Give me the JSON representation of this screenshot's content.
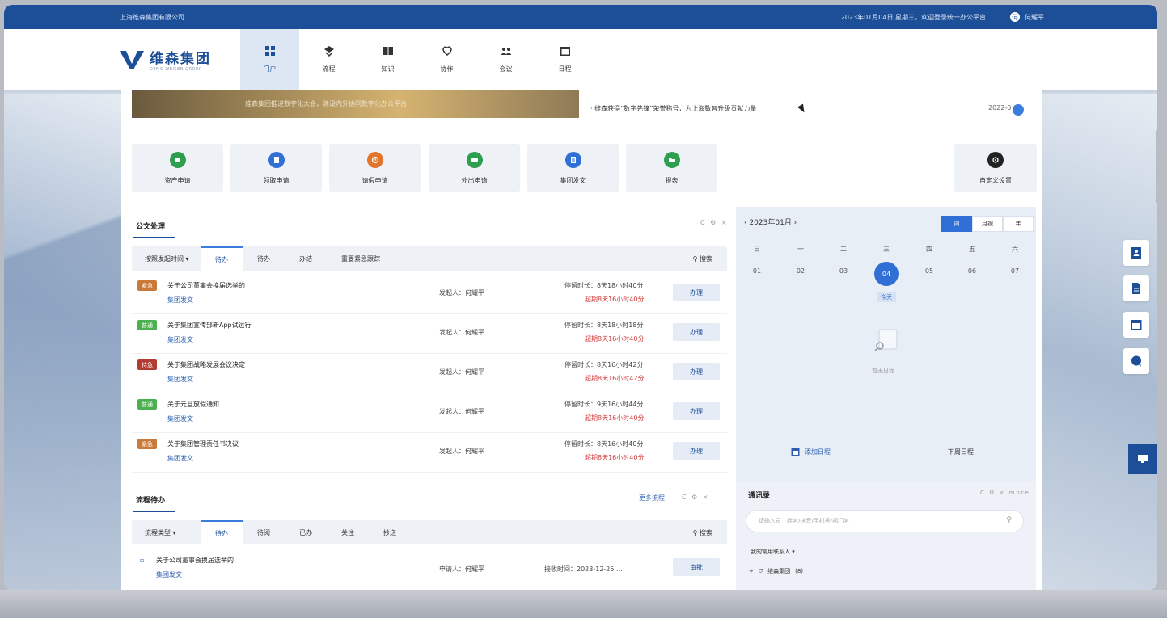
{
  "topbar": {
    "company": "上海维森集团有限公司",
    "date_welcome": "2023年01月04日 星期三，欢迎登录统一办公平台",
    "user_name": "何耀平",
    "avatar_glyph": "何"
  },
  "logo": {
    "cn": "维森集团",
    "en": "DEMO WEISEN GROUP"
  },
  "nav": [
    {
      "label": "门户",
      "icon": "portal-icon"
    },
    {
      "label": "流程",
      "icon": "flow-icon"
    },
    {
      "label": "知识",
      "icon": "book-icon"
    },
    {
      "label": "协作",
      "icon": "collab-icon"
    },
    {
      "label": "会议",
      "icon": "meeting-icon"
    },
    {
      "label": "日程",
      "icon": "calendar-icon"
    }
  ],
  "banner": {
    "text": "维森集团推进数字化大会，建设内外协同数字化办公平台"
  },
  "notice": {
    "text": "· 维森获得“数字先锋”荣誉称号，为上海数智升级贡献力量",
    "date": "2022-0"
  },
  "quick_links": [
    {
      "label": "资产申请",
      "color": "#2e9e4f",
      "icon": "asset-icon"
    },
    {
      "label": "领取申请",
      "color": "#2f6fd6",
      "icon": "form-icon"
    },
    {
      "label": "请假申请",
      "color": "#e0762b",
      "icon": "clock-icon"
    },
    {
      "label": "外出申请",
      "color": "#2e9e4f",
      "icon": "car-icon"
    },
    {
      "label": "集团发文",
      "color": "#2f6fd6",
      "icon": "doc-icon"
    },
    {
      "label": "报表",
      "color": "#2e9e4f",
      "icon": "folder-icon"
    },
    {
      "label": "自定义设置",
      "color": "#222222",
      "icon": "settings-icon"
    }
  ],
  "doc_section": {
    "title": "公文处理",
    "tools": "C ⚙ ×",
    "filter": "按照发起时间 ▾",
    "tabs": [
      "待办",
      "待办",
      "办结",
      "重要紧急跟踪"
    ],
    "search": "搜索",
    "rows": [
      {
        "tag": "紧急",
        "tag_color": "#c97a3a",
        "title": "关于公司董事会换届选举的",
        "sub": "集团发文",
        "sender": "发起人：何耀平",
        "stay": "停留时长：8天18小时40分",
        "overdue": "超期8天16小时40分",
        "btn": "办理"
      },
      {
        "tag": "普通",
        "tag_color": "#4caf50",
        "title": "关于集团宣传部新App试运行",
        "sub": "集团发文",
        "sender": "发起人：何耀平",
        "stay": "停留时长：8天18小时18分",
        "overdue": "超期8天16小时40分",
        "btn": "办理"
      },
      {
        "tag": "特急",
        "tag_color": "#b23b32",
        "title": "关于集团战略发展会议决定",
        "sub": "集团发文",
        "sender": "发起人：何耀平",
        "stay": "停留时长：8天16小时42分",
        "overdue": "超期8天16小时42分",
        "btn": "办理"
      },
      {
        "tag": "普通",
        "tag_color": "#4caf50",
        "title": "关于元旦放假通知",
        "sub": "集团发文",
        "sender": "发起人：何耀平",
        "stay": "停留时长：9天16小时44分",
        "overdue": "超期8天16小时40分",
        "btn": "办理"
      },
      {
        "tag": "紧急",
        "tag_color": "#c97a3a",
        "title": "关于集团管理责任书决议",
        "sub": "集团发文",
        "sender": "发起人：何耀平",
        "stay": "停留时长：8天16小时40分",
        "overdue": "超期8天16小时40分",
        "btn": "办理"
      }
    ]
  },
  "flow_section": {
    "title": "流程待办",
    "link": "更多流程",
    "tools": "C ⚙ ×",
    "filter": "流程类型 ▾",
    "tabs": [
      "待办",
      "待阅",
      "已办",
      "关注",
      "抄送"
    ],
    "search": "搜索",
    "rows": [
      {
        "title": "关于公司董事会换届选举的",
        "sub": "集团发文",
        "sender": "申请人：何耀平",
        "time": "接收时间：2023-12-25 ...",
        "btn": "审批"
      }
    ]
  },
  "calendar": {
    "month": "‹  2023年01月  ›",
    "views": [
      "周",
      "月视",
      "年"
    ],
    "active_view": "周",
    "weekdays": [
      "日",
      "一",
      "二",
      "三",
      "四",
      "五",
      "六"
    ],
    "days": [
      "01",
      "02",
      "03",
      "04",
      "05",
      "06",
      "07"
    ],
    "today": "04",
    "today_label": "今天",
    "empty_text": "暂无日程",
    "prev_month": "添加日程",
    "next_month": "下周日程"
  },
  "address_book": {
    "title": "通讯录",
    "tools": "C ⚙ × more",
    "placeholder": "请输入员工姓名/拼音/手机号/部门名",
    "group_line": "我的常用联系人 ▾",
    "tree_root": "维森集团",
    "tree_count": "(8)"
  }
}
